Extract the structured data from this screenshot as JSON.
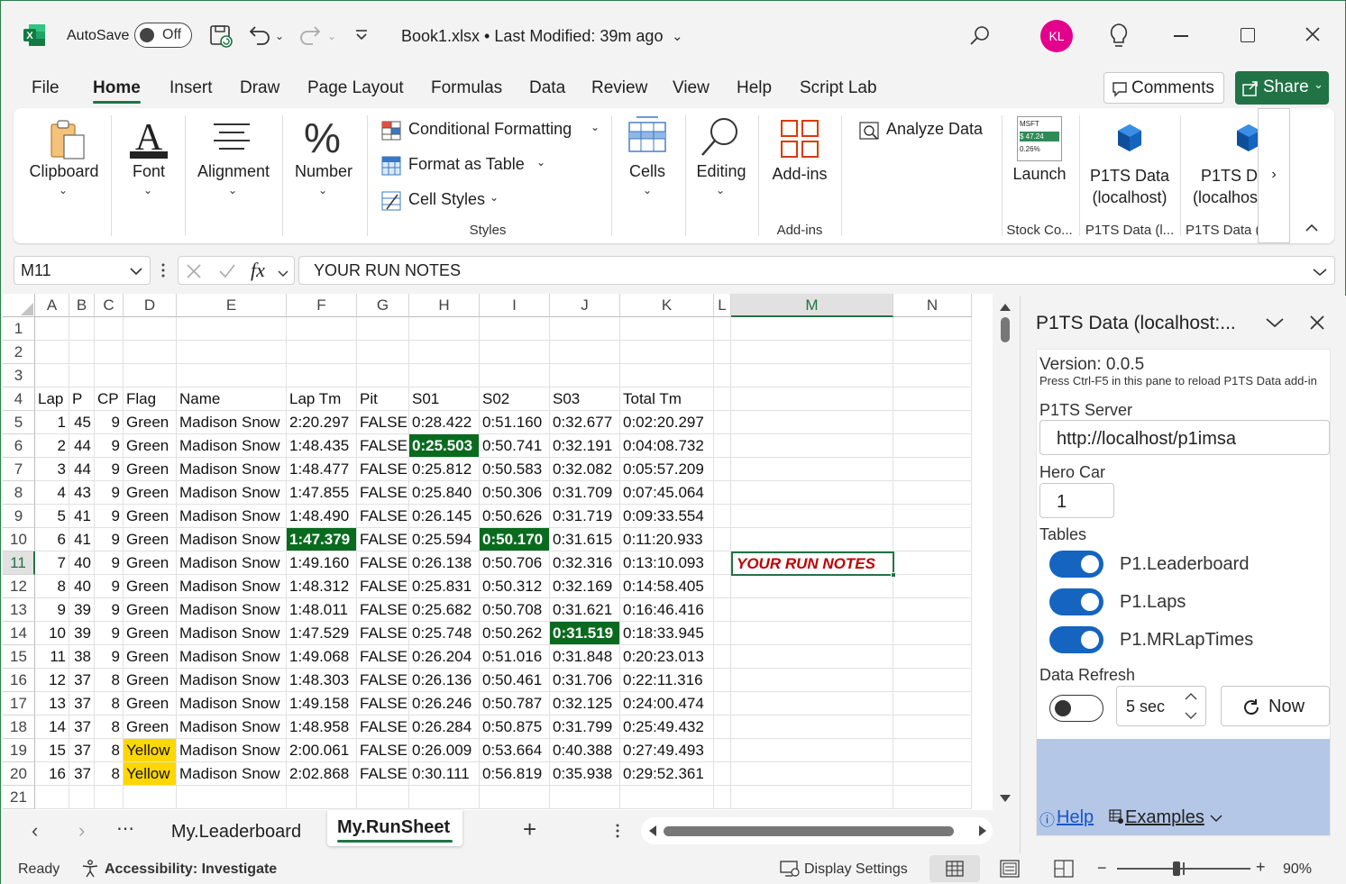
{
  "titlebar": {
    "autosave_label": "AutoSave",
    "autosave_state": "Off",
    "doc_title": "Book1.xlsx • Last Modified: 39m ago",
    "user_initials": "KL",
    "avatar_color": "#e3008c"
  },
  "menu": {
    "tabs": [
      "File",
      "Home",
      "Insert",
      "Draw",
      "Page Layout",
      "Formulas",
      "Data",
      "Review",
      "View",
      "Help",
      "Script Lab"
    ],
    "active": "Home",
    "comments_label": "Comments",
    "share_label": "Share"
  },
  "ribbon": {
    "clipboard": "Clipboard",
    "font": "Font",
    "alignment": "Alignment",
    "number": "Number",
    "conditional_formatting": "Conditional Formatting",
    "format_as_table": "Format as Table",
    "cell_styles": "Cell Styles",
    "styles_group": "Styles",
    "cells": "Cells",
    "editing": "Editing",
    "addins": "Add-ins",
    "addins_group": "Add-ins",
    "analyze_data": "Analyze Data",
    "stock_ticker": "MSFT",
    "stock_price": "$ 47.24",
    "stock_change": "0.26%",
    "launch": "Launch",
    "stock_group": "Stock Co...",
    "p1ts_1_line1": "P1TS Data",
    "p1ts_1_line2": "(localhost)",
    "p1ts_1_group": "P1TS Data (l...",
    "p1ts_2_line1": "P1TS D",
    "p1ts_2_line2": "(localhos",
    "p1ts_2_group": "P1TS Data ("
  },
  "formula_bar": {
    "name_box": "M11",
    "formula": "YOUR RUN NOTES",
    "fx": "fx"
  },
  "grid": {
    "columns": [
      "A",
      "B",
      "C",
      "D",
      "E",
      "F",
      "G",
      "H",
      "I",
      "J",
      "K",
      "L",
      "M",
      "N"
    ],
    "rows": [
      "1",
      "2",
      "3",
      "4",
      "5",
      "6",
      "7",
      "8",
      "9",
      "10",
      "11",
      "12",
      "13",
      "14",
      "15",
      "16",
      "17",
      "18",
      "19",
      "20",
      "21"
    ],
    "headers": [
      "Lap",
      "P",
      "CP",
      "Flag",
      "Name",
      "Lap Tm",
      "Pit",
      "S01",
      "S02",
      "S03",
      "Total Tm"
    ],
    "data": [
      [
        "1",
        "45",
        "9",
        "Green",
        "Madison Snow",
        "2:20.297",
        "FALSE",
        "0:28.422",
        "0:51.160",
        "0:32.677",
        "0:02:20.297"
      ],
      [
        "2",
        "44",
        "9",
        "Green",
        "Madison Snow",
        "1:48.435",
        "FALSE",
        "0:25.503",
        "0:50.741",
        "0:32.191",
        "0:04:08.732"
      ],
      [
        "3",
        "44",
        "9",
        "Green",
        "Madison Snow",
        "1:48.477",
        "FALSE",
        "0:25.812",
        "0:50.583",
        "0:32.082",
        "0:05:57.209"
      ],
      [
        "4",
        "43",
        "9",
        "Green",
        "Madison Snow",
        "1:47.855",
        "FALSE",
        "0:25.840",
        "0:50.306",
        "0:31.709",
        "0:07:45.064"
      ],
      [
        "5",
        "41",
        "9",
        "Green",
        "Madison Snow",
        "1:48.490",
        "FALSE",
        "0:26.145",
        "0:50.626",
        "0:31.719",
        "0:09:33.554"
      ],
      [
        "6",
        "41",
        "9",
        "Green",
        "Madison Snow",
        "1:47.379",
        "FALSE",
        "0:25.594",
        "0:50.170",
        "0:31.615",
        "0:11:20.933"
      ],
      [
        "7",
        "40",
        "9",
        "Green",
        "Madison Snow",
        "1:49.160",
        "FALSE",
        "0:26.138",
        "0:50.706",
        "0:32.316",
        "0:13:10.093"
      ],
      [
        "8",
        "40",
        "9",
        "Green",
        "Madison Snow",
        "1:48.312",
        "FALSE",
        "0:25.831",
        "0:50.312",
        "0:32.169",
        "0:14:58.405"
      ],
      [
        "9",
        "39",
        "9",
        "Green",
        "Madison Snow",
        "1:48.011",
        "FALSE",
        "0:25.682",
        "0:50.708",
        "0:31.621",
        "0:16:46.416"
      ],
      [
        "10",
        "39",
        "9",
        "Green",
        "Madison Snow",
        "1:47.529",
        "FALSE",
        "0:25.748",
        "0:50.262",
        "0:31.519",
        "0:18:33.945"
      ],
      [
        "11",
        "38",
        "9",
        "Green",
        "Madison Snow",
        "1:49.068",
        "FALSE",
        "0:26.204",
        "0:51.016",
        "0:31.848",
        "0:20:23.013"
      ],
      [
        "12",
        "37",
        "8",
        "Green",
        "Madison Snow",
        "1:48.303",
        "FALSE",
        "0:26.136",
        "0:50.461",
        "0:31.706",
        "0:22:11.316"
      ],
      [
        "13",
        "37",
        "8",
        "Green",
        "Madison Snow",
        "1:49.158",
        "FALSE",
        "0:26.246",
        "0:50.787",
        "0:32.125",
        "0:24:00.474"
      ],
      [
        "14",
        "37",
        "8",
        "Green",
        "Madison Snow",
        "1:48.958",
        "FALSE",
        "0:26.284",
        "0:50.875",
        "0:31.799",
        "0:25:49.432"
      ],
      [
        "15",
        "37",
        "8",
        "Yellow",
        "Madison Snow",
        "2:00.061",
        "FALSE",
        "0:26.009",
        "0:53.664",
        "0:40.388",
        "0:27:49.493"
      ],
      [
        "16",
        "37",
        "8",
        "Yellow",
        "Madison Snow",
        "2:02.868",
        "FALSE",
        "0:30.111",
        "0:56.819",
        "0:35.938",
        "0:29:52.361"
      ]
    ],
    "best_cells": [
      [
        1,
        7
      ],
      [
        5,
        5
      ],
      [
        5,
        8
      ],
      [
        9,
        9
      ]
    ],
    "run_notes": "YOUR RUN NOTES",
    "colors": {
      "best_bg": "#0a6b1f",
      "yellow_bg": "#ffd700",
      "notes_text": "#c00000",
      "selection": "#217346"
    }
  },
  "sheets": {
    "tabs": [
      "My.Leaderboard",
      "My.RunSheet"
    ],
    "active": "My.RunSheet"
  },
  "pane": {
    "title": "P1TS Data (localhost:...",
    "version": "Version: 0.0.5",
    "reload_hint": "Press Ctrl-F5 in this pane to reload P1TS Data add-in",
    "server_label": "P1TS Server",
    "server_value": "http://localhost/p1imsa",
    "hero_label": "Hero Car",
    "hero_value": "1",
    "tables_label": "Tables",
    "tables": [
      "P1.Leaderboard",
      "P1.Laps",
      "P1.MRLapTimes"
    ],
    "refresh_label": "Data Refresh",
    "refresh_interval": "5 sec",
    "now_label": "Now",
    "help_label": "Help",
    "examples_label": "Examples",
    "footer_color": "#b4c7e7"
  },
  "status": {
    "ready": "Ready",
    "accessibility": "Accessibility: Investigate",
    "display_settings": "Display Settings",
    "zoom": "90%"
  }
}
